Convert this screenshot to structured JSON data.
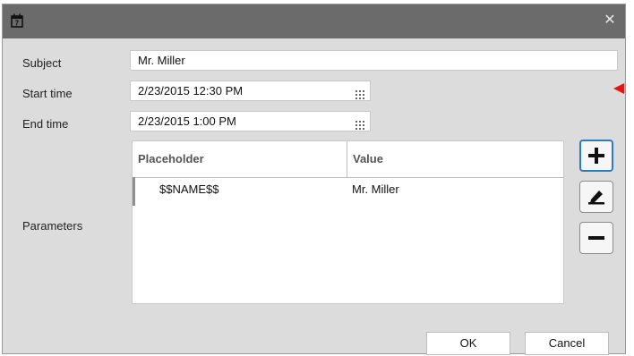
{
  "window": {
    "title": "",
    "icon": "calendar-icon",
    "close_glyph": "✕"
  },
  "form": {
    "subject_label": "Subject",
    "subject_value": "Mr. Miller",
    "start_label": "Start time",
    "start_value": "2/23/2015 12:30 PM",
    "end_label": "End time",
    "end_value": "2/23/2015 1:00 PM",
    "parameters_label": "Parameters"
  },
  "table": {
    "headers": [
      "Placeholder",
      "Value"
    ],
    "rows": [
      {
        "placeholder": "$$NAME$$",
        "value": "Mr. Miller"
      }
    ]
  },
  "buttons": {
    "ok": "OK",
    "cancel": "Cancel"
  },
  "colors": {
    "titlebar": "#6b6b6b",
    "dialog_bg": "#dcdcdc",
    "focus": "#2a7cc7",
    "pointer": "#e01616"
  }
}
